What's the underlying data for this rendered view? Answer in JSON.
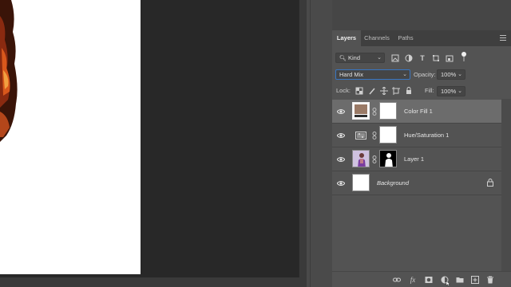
{
  "panel": {
    "tabs": [
      {
        "label": "Layers",
        "active": true
      },
      {
        "label": "Channels",
        "active": false
      },
      {
        "label": "Paths",
        "active": false
      }
    ],
    "filter": {
      "value": "Kind"
    },
    "blend_mode": {
      "value": "Hard Mix"
    },
    "opacity": {
      "label": "Opacity:",
      "value": "100%"
    },
    "lock": {
      "label": "Lock:"
    },
    "fill": {
      "label": "Fill:",
      "value": "100%"
    },
    "layers": [
      {
        "name": "Color Fill 1",
        "visible": true,
        "selected": true,
        "fill_color": "#9a7a66"
      },
      {
        "name": "Hue/Saturation 1",
        "visible": true,
        "selected": false
      },
      {
        "name": "Layer 1",
        "visible": true,
        "selected": false
      },
      {
        "name": "Background",
        "visible": true,
        "selected": false,
        "locked": true
      }
    ],
    "bottom_icons": [
      "link-icon",
      "fx-icon",
      "mask-icon",
      "adjustment-icon",
      "folder-icon",
      "new-layer-icon",
      "trash-icon"
    ],
    "fx_label": "fx"
  },
  "colors": {
    "panel_bg": "#535353",
    "selected_row": "#6c6c6c",
    "blend_border": "#3876c2"
  }
}
